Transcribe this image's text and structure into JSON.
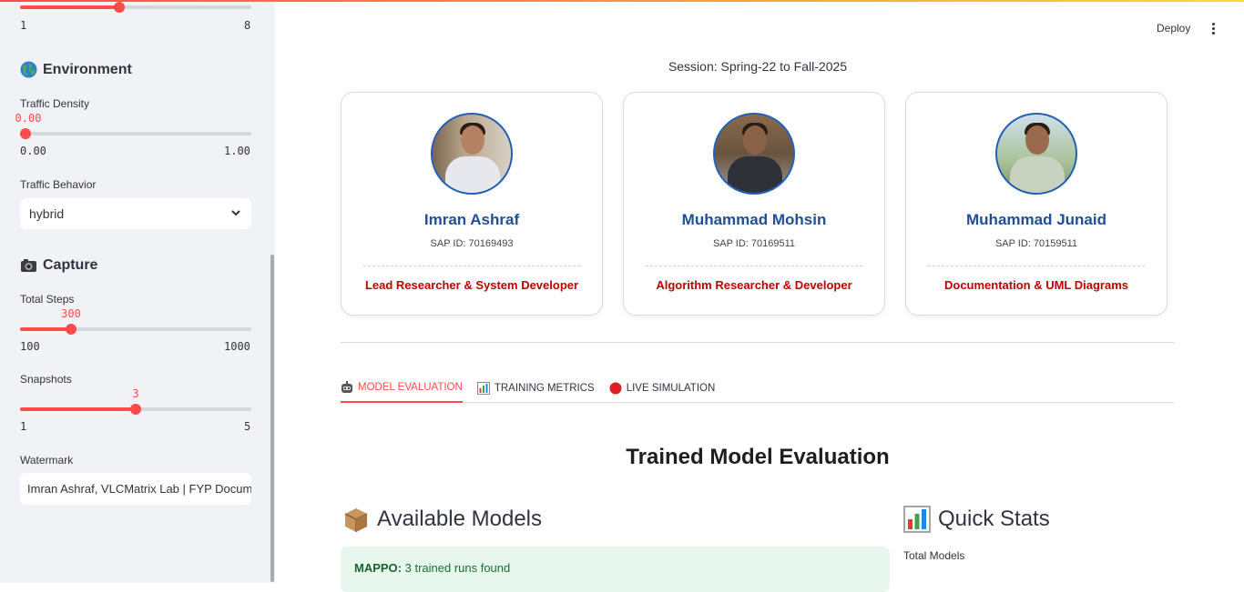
{
  "sidebar": {
    "top_slider": {
      "min": "1",
      "max": "8",
      "fraction": 0.43
    },
    "environment": {
      "title": "Environment",
      "icon": "globe-icon",
      "traffic_density": {
        "label": "Traffic Density",
        "value": "0.00",
        "min": "0.00",
        "max": "1.00",
        "fraction": 0.0
      },
      "traffic_behavior": {
        "label": "Traffic Behavior",
        "value": "hybrid"
      }
    },
    "capture": {
      "title": "Capture",
      "icon": "camera-icon",
      "total_steps": {
        "label": "Total Steps",
        "value": "300",
        "min": "100",
        "max": "1000",
        "fraction": 0.222
      },
      "snapshots": {
        "label": "Snapshots",
        "value": "3",
        "min": "1",
        "max": "5",
        "fraction": 0.5
      },
      "watermark": {
        "label": "Watermark",
        "value": "Imran Ashraf, VLCMatrix Lab | FYP Documentation"
      }
    }
  },
  "header": {
    "deploy_label": "Deploy"
  },
  "main": {
    "session": "Session: Spring-22 to Fall-2025",
    "team": [
      {
        "name": "Imran Ashraf",
        "sap": "SAP ID: 70169493",
        "role": "Lead Researcher & System Developer"
      },
      {
        "name": "Muhammad Mohsin",
        "sap": "SAP ID: 70169511",
        "role": "Algorithm Researcher & Developer"
      },
      {
        "name": "Muhammad Junaid",
        "sap": "SAP ID: 70159511",
        "role": "Documentation & UML Diagrams"
      }
    ],
    "tabs": [
      {
        "label": "MODEL EVALUATION",
        "icon": "robot-icon",
        "active": true
      },
      {
        "label": "TRAINING METRICS",
        "icon": "bar-chart-icon",
        "active": false
      },
      {
        "label": "LIVE SIMULATION",
        "icon": "red-circle-icon",
        "active": false
      }
    ],
    "page_title": "Trained Model Evaluation",
    "available_models": {
      "title": "Available Models",
      "icon": "package-icon",
      "alert_name": "MAPPO:",
      "alert_text": " 3 trained runs found"
    },
    "quick_stats": {
      "title": "Quick Stats",
      "icon": "bar-chart-icon",
      "total_models_label": "Total Models"
    }
  },
  "colors": {
    "accent": "#ff4b4b",
    "name_blue": "#1f4f96",
    "role_red": "#c00000",
    "success_bg": "#e8f7ed"
  }
}
